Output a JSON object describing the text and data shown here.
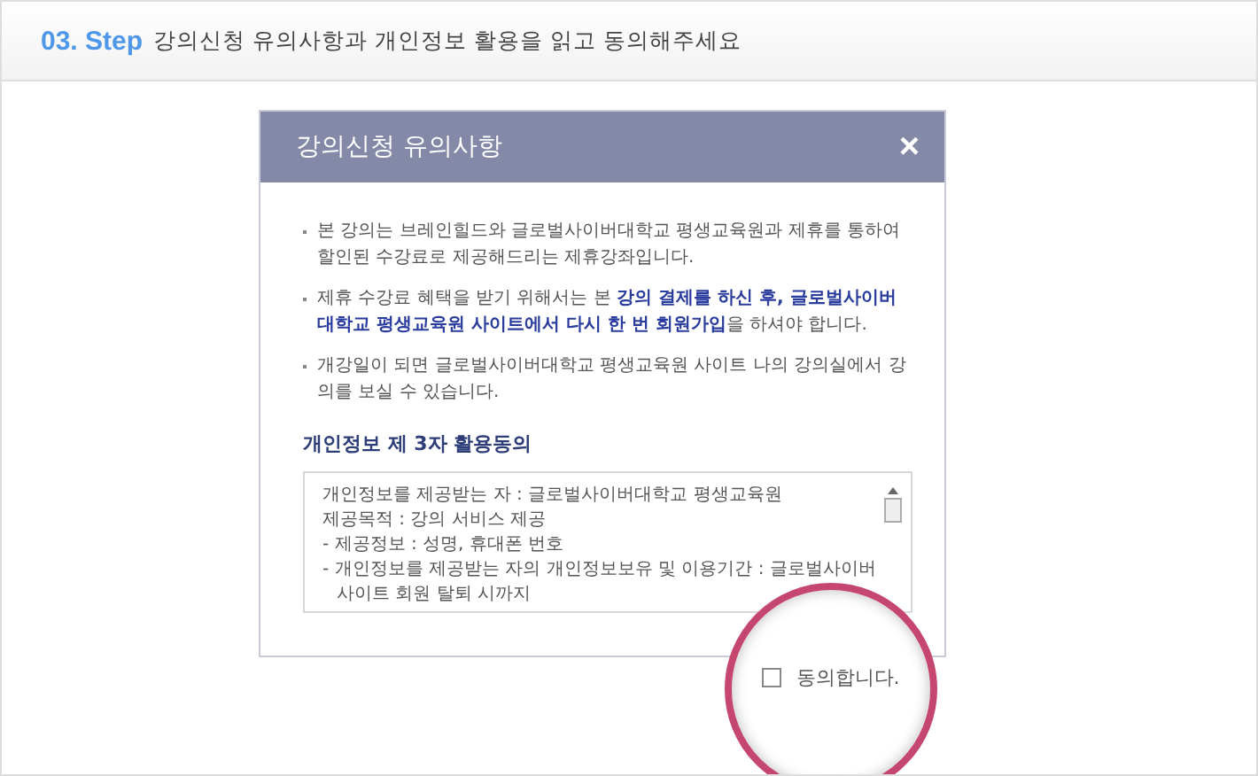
{
  "step": {
    "number": "03. Step",
    "title": "강의신청 유의사항과 개인정보 활용을 읽고 동의해주세요"
  },
  "dialog": {
    "title": "강의신청 유의사항",
    "close": "×",
    "notes": [
      "본 강의는 브레인힐드와 글로벌사이버대학교 평생교육원과 제휴를 통하여 할인된 수강료로 제공해드리는 제휴강좌입니다.",
      "제휴 수강료 혜택을 받기 위해서는 본 **강의 결제를 하신 후, 글로벌사이버대학교 평생교육원 사이트에서 다시 한 번 회원가입**을 하셔야 합니다.",
      "개강일이 되면 글로벌사이버대학교 평생교육원 사이트 나의 강의실에서 강의를 보실 수 있습니다."
    ],
    "consent_title": "개인정보 제 3자 활용동의",
    "consent_lines": [
      "개인정보를 제공받는 자 : 글로벌사이버대학교 평생교육원",
      "제공목적 : 강의 서비스 제공",
      "- 제공정보 : 성명, 휴대폰 번호",
      "- 개인정보를 제공받는 자의 개인정보보유 및 이용기간 : 글로벌사이버",
      "사이트 회원 탈퇴 시까지"
    ],
    "agree": {
      "label": "동의합니다.",
      "checked": false
    }
  }
}
